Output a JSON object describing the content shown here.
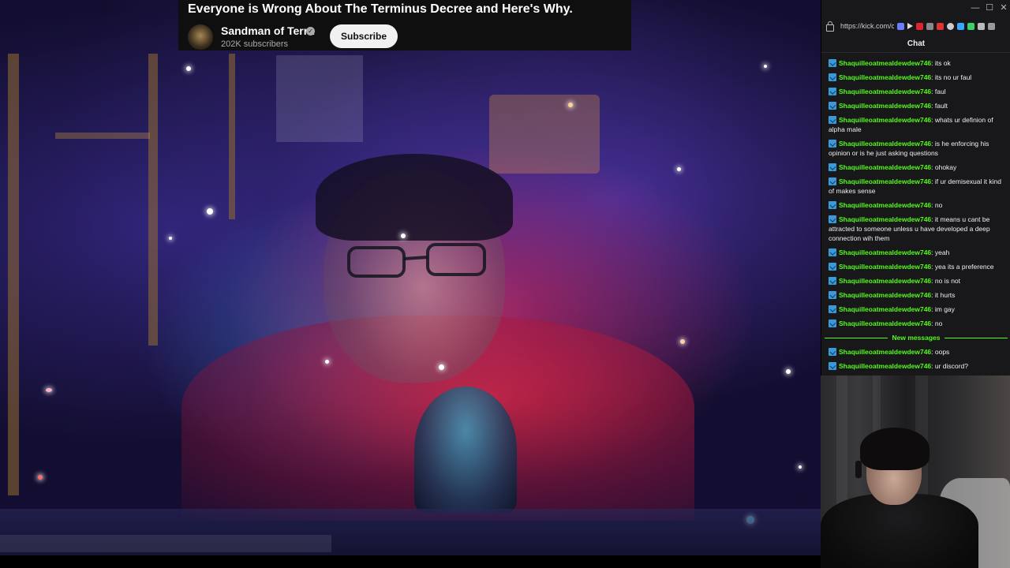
{
  "video": {
    "title": "Everyone is Wrong About The Terminus Decree and Here's Why.",
    "channel_name": "Sandman of Terra",
    "subscribers": "202K subscribers",
    "subscribe_label": "Subscribe"
  },
  "browser": {
    "url": "https://kick.com/c",
    "window_controls": [
      "—",
      "☐",
      "✕"
    ]
  },
  "chat": {
    "header": "Chat",
    "messages": [
      {
        "user": "Shaquilleoatmealdewdew746",
        "text": ": its ok"
      },
      {
        "user": "Shaquilleoatmealdewdew746",
        "text": ": its no ur faul"
      },
      {
        "user": "Shaquilleoatmealdewdew746",
        "text": ": faul"
      },
      {
        "user": "Shaquilleoatmealdewdew746",
        "text": ": fault"
      },
      {
        "user": "Shaquilleoatmealdewdew746",
        "text": ": whats ur definion of alpha male"
      },
      {
        "user": "Shaquilleoatmealdewdew746",
        "text": ": is he enforcing his opinion or is he just asking questions"
      },
      {
        "user": "Shaquilleoatmealdewdew746",
        "text": ": ohokay"
      },
      {
        "user": "Shaquilleoatmealdewdew746",
        "text": ": if ur demisexual it kind of makes sense"
      },
      {
        "user": "Shaquilleoatmealdewdew746",
        "text": ": no"
      },
      {
        "user": "Shaquilleoatmealdewdew746",
        "text": ": it means u cant be attracted to someone unless u have developed a deep connection wih them"
      },
      {
        "user": "Shaquilleoatmealdewdew746",
        "text": ": yeah"
      },
      {
        "user": "Shaquilleoatmealdewdew746",
        "text": ": yea its a preference"
      },
      {
        "user": "Shaquilleoatmealdewdew746",
        "text": ": no is not"
      },
      {
        "user": "Shaquilleoatmealdewdew746",
        "text": ": it hurts"
      },
      {
        "user": "Shaquilleoatmealdewdew746",
        "text": ": im gay"
      },
      {
        "user": "Shaquilleoatmealdewdew746",
        "text": ": no"
      }
    ],
    "new_messages_label": "New messages",
    "new_messages": [
      {
        "user": "Shaquilleoatmealdewdew746",
        "text": ": oops"
      },
      {
        "user": "Shaquilleoatmealdewdew746",
        "text": ": ur discord?"
      }
    ]
  },
  "colors": {
    "accent": "#53fc18",
    "chat_bg": "#18181b",
    "overlay_bg": "#0f0f0f"
  }
}
